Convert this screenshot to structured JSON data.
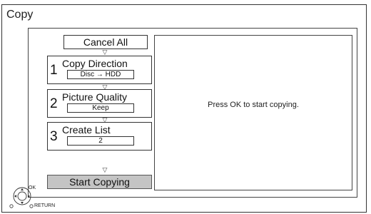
{
  "window": {
    "title": "Copy"
  },
  "buttons": {
    "cancel_all": "Cancel All",
    "start_copying": "Start Copying"
  },
  "steps": [
    {
      "number": "1",
      "label": "Copy Direction",
      "value": "Disc → HDD"
    },
    {
      "number": "2",
      "label": "Picture Quality",
      "value": "Keep"
    },
    {
      "number": "3",
      "label": "Create List",
      "value": "2"
    }
  ],
  "message": "Press OK to start copying.",
  "remote": {
    "ok_label": "OK",
    "return_label": "RETURN"
  },
  "icons": {
    "flow_arrow": "▽"
  }
}
